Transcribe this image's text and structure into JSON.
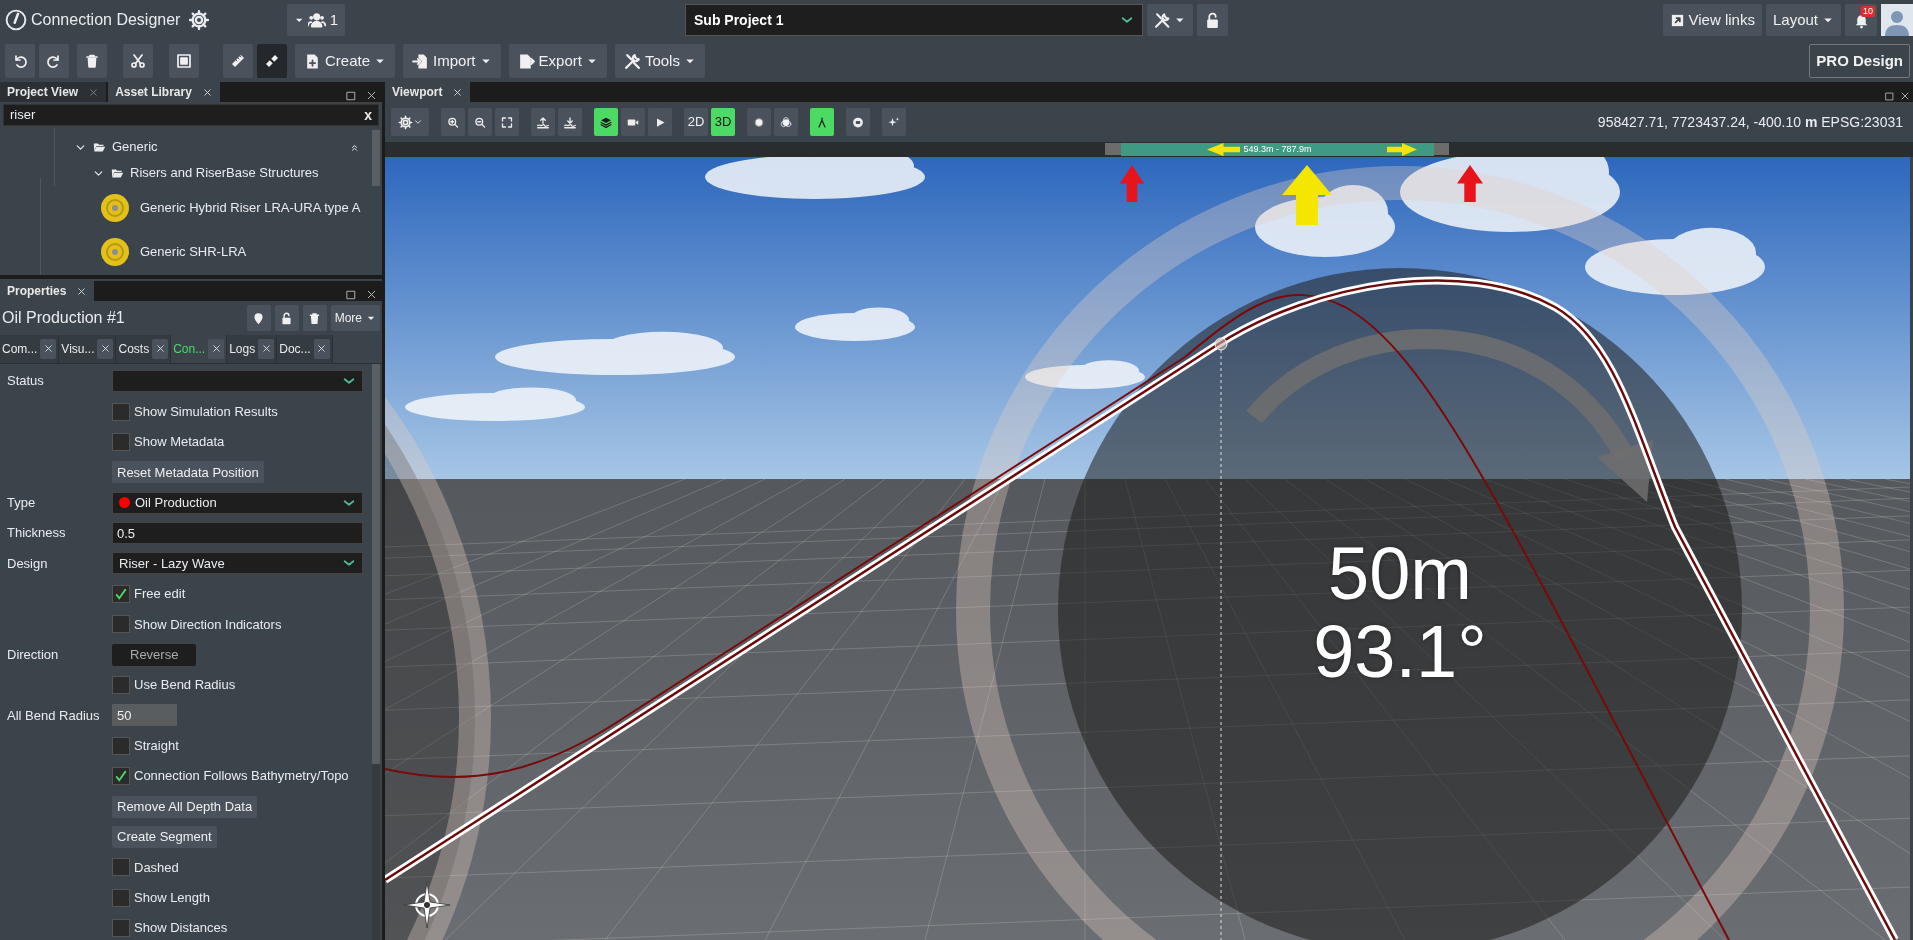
{
  "app": {
    "title": "Connection Designer"
  },
  "users": {
    "count": "1"
  },
  "project": {
    "value": "Sub Project 1"
  },
  "links": {
    "view_links": "View links",
    "layout": "Layout",
    "notifications": "10"
  },
  "edit_toolbar": {
    "measure_off_active": true,
    "menus": [
      "Create",
      "Import",
      "Export",
      "Tools"
    ]
  },
  "pro_button": "PRO Design",
  "library": {
    "tabs": [
      {
        "label": "Project View",
        "selected": false
      },
      {
        "label": "Asset Library",
        "selected": true
      }
    ],
    "search": {
      "value": "riser",
      "clear": "x"
    },
    "tree": [
      {
        "label": "Generic",
        "expanded": true,
        "children": [
          {
            "label": "Risers and RiserBase Structures",
            "expanded": true,
            "children": [
              {
                "label": "Generic Hybrid Riser LRA-URA type A"
              },
              {
                "label": "Generic SHR-LRA"
              }
            ]
          }
        ]
      }
    ]
  },
  "properties": {
    "tab": "Properties",
    "title": "Oil Production #1",
    "more": "More",
    "tabs": [
      {
        "label": "Com...",
        "selected": false
      },
      {
        "label": "Visu...",
        "selected": false
      },
      {
        "label": "Costs",
        "selected": false
      },
      {
        "label": "Con...",
        "selected": true
      },
      {
        "label": "Logs",
        "selected": false
      },
      {
        "label": "Doc...",
        "selected": false
      }
    ],
    "fields": [
      {
        "kind": "select",
        "label": "Status"
      },
      {
        "kind": "checkbox",
        "text": "Show Simulation Results",
        "checked": false
      },
      {
        "kind": "checkbox",
        "text": "Show Metadata",
        "checked": false
      },
      {
        "kind": "button",
        "text": "Reset Metadata Position",
        "disabled": false
      },
      {
        "kind": "select",
        "label": "Type",
        "value": "Oil Production",
        "color": "#ff0000"
      },
      {
        "kind": "input",
        "label": "Thickness",
        "value": "0.5",
        "disabled": false
      },
      {
        "kind": "select",
        "label": "Design",
        "value": "Riser - Lazy Wave"
      },
      {
        "kind": "checkbox",
        "text": "Free edit",
        "checked": true
      },
      {
        "kind": "checkbox",
        "text": "Show Direction Indicators",
        "checked": false
      },
      {
        "kind": "button",
        "label": "Direction",
        "text": "Reverse",
        "disabled": true
      },
      {
        "kind": "checkbox",
        "text": "Use Bend Radius",
        "checked": false
      },
      {
        "kind": "input",
        "label": "All Bend Radius",
        "value": "50",
        "disabled": true
      },
      {
        "kind": "checkbox",
        "text": "Straight",
        "checked": false
      },
      {
        "kind": "checkbox",
        "text": "Connection Follows Bathymetry/Topo",
        "checked": true
      },
      {
        "kind": "button",
        "text": "Remove All Depth Data",
        "disabled": false
      },
      {
        "kind": "button",
        "text": "Create Segment",
        "disabled": false
      },
      {
        "kind": "checkbox",
        "text": "Dashed",
        "checked": false
      },
      {
        "kind": "checkbox",
        "text": "Show Length",
        "checked": false
      },
      {
        "kind": "checkbox",
        "text": "Show Distances",
        "checked": false
      }
    ]
  },
  "viewport": {
    "tab": "Viewport",
    "layers_on": true,
    "line_tool_on": true,
    "modes": [
      {
        "label": "2D",
        "selected": false
      },
      {
        "label": "3D",
        "selected": true
      }
    ],
    "coordinates": "958427.71, 7723437.24, -400.10 **m** EPSG:23031",
    "timeline_range": "549.3m - 787.9m",
    "measurement": {
      "distance": "50m",
      "angle": "93.1°"
    }
  }
}
